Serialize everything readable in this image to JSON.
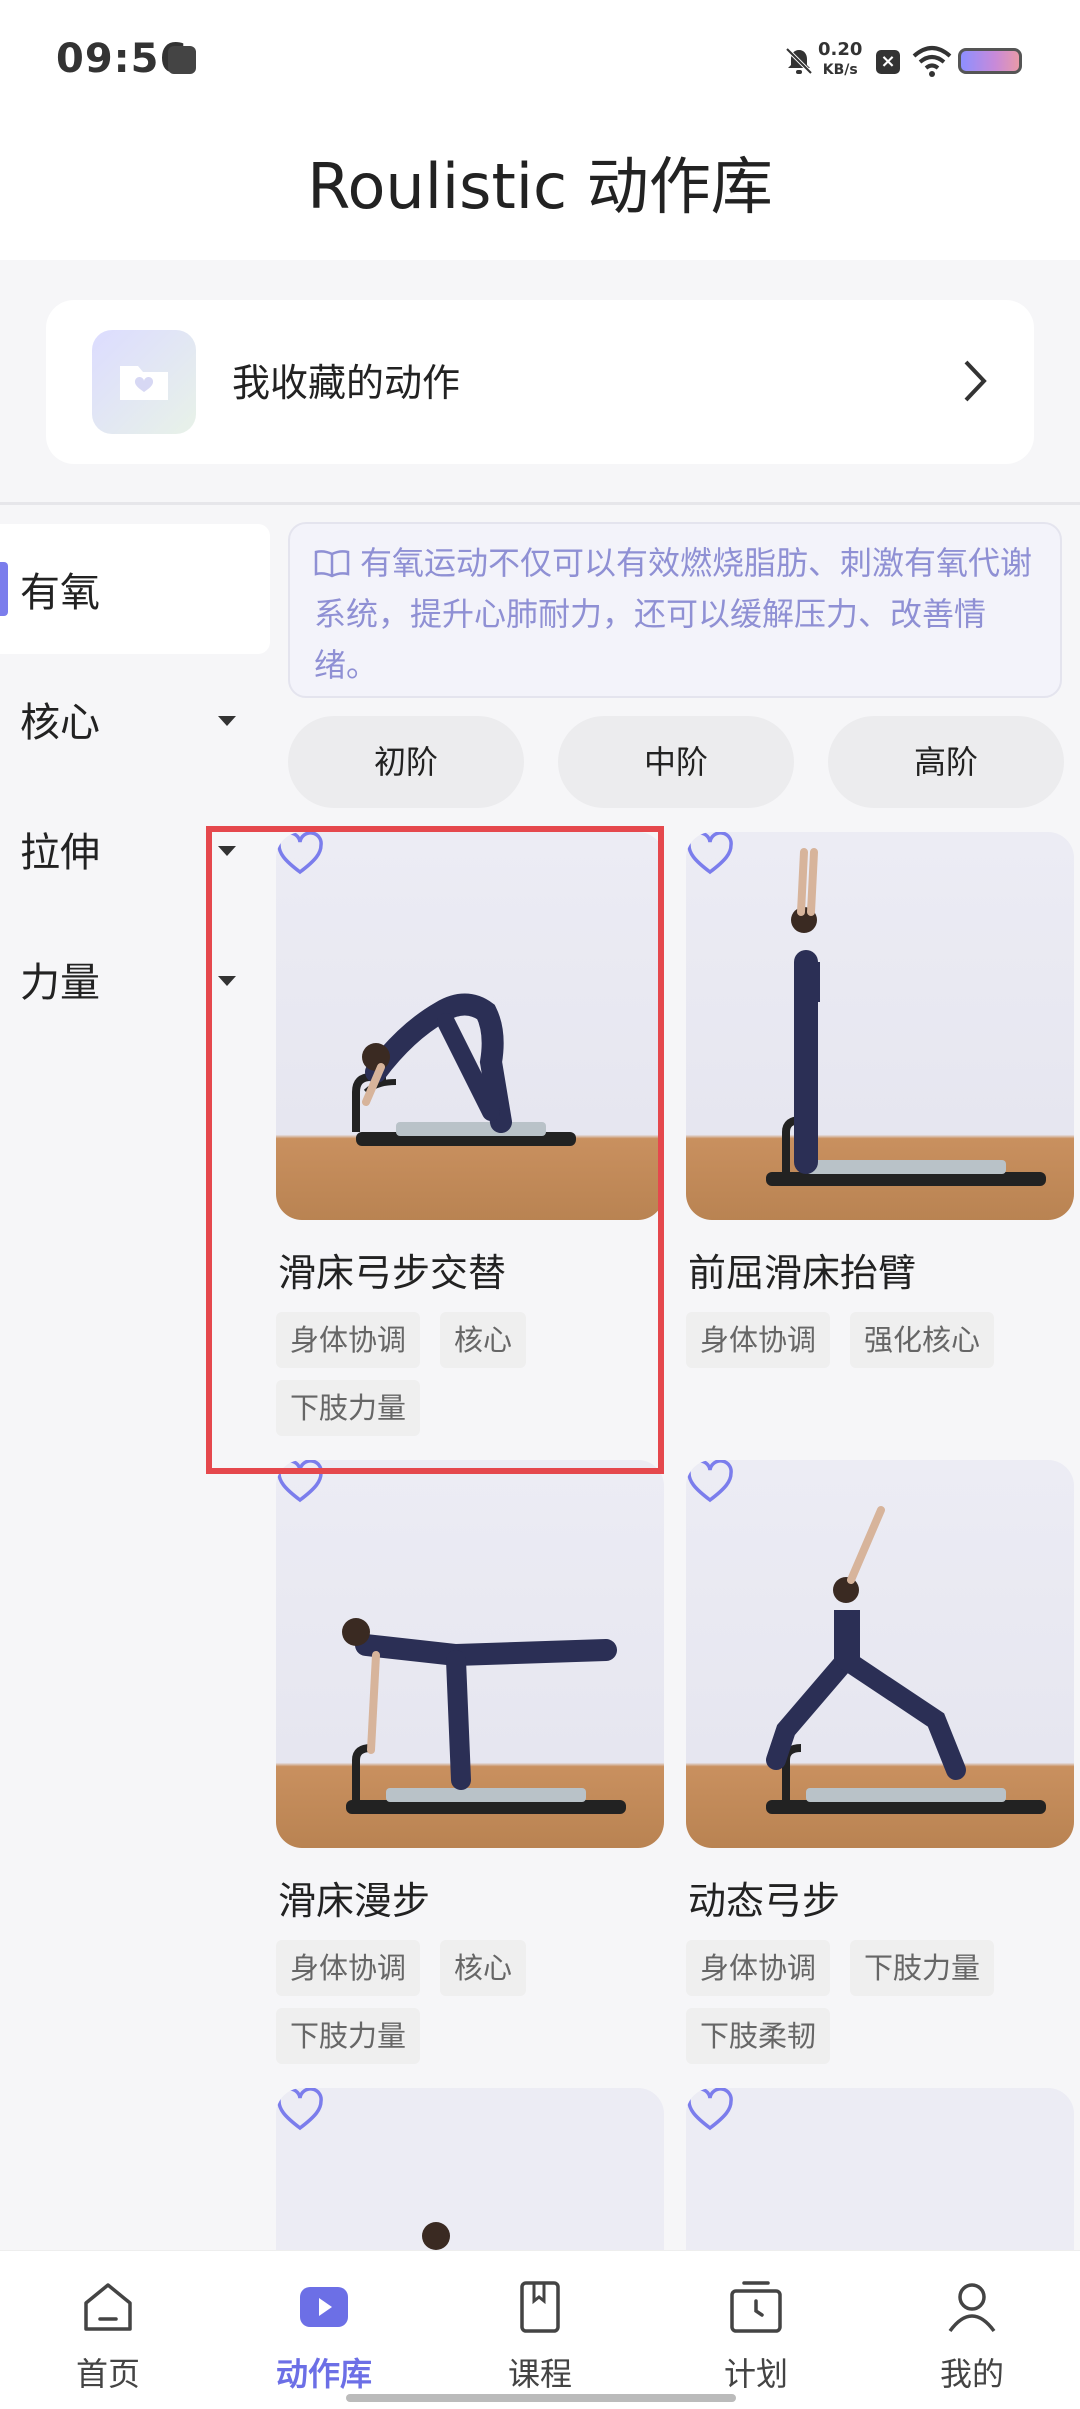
{
  "status": {
    "time": "09:56",
    "net_speed": "0.20",
    "net_unit": "KB/s"
  },
  "header": {
    "title": "Roulistic 动作库"
  },
  "favorites": {
    "label": "我收藏的动作"
  },
  "sidebar": {
    "items": [
      {
        "label": "有氧",
        "active": true
      },
      {
        "label": "核心",
        "active": false
      },
      {
        "label": "拉伸",
        "active": false
      },
      {
        "label": "力量",
        "active": false
      }
    ]
  },
  "description": "有氧运动不仅可以有效燃烧脂肪、刺激有氧代谢系统，提升心肺耐力，还可以缓解压力、改善情绪。",
  "levels": [
    "初阶",
    "中阶",
    "高阶"
  ],
  "cards": [
    {
      "title": "滑床弓步交替",
      "tags": [
        "身体协调",
        "核心",
        "下肢力量"
      ]
    },
    {
      "title": "前屈滑床抬臂",
      "tags": [
        "身体协调",
        "强化核心"
      ]
    },
    {
      "title": "滑床漫步",
      "tags": [
        "身体协调",
        "核心",
        "下肢力量"
      ]
    },
    {
      "title": "动态弓步",
      "tags": [
        "身体协调",
        "下肢力量",
        "下肢柔韧"
      ]
    }
  ],
  "tabbar": {
    "items": [
      {
        "label": "首页",
        "icon": "home-icon"
      },
      {
        "label": "动作库",
        "icon": "play-icon"
      },
      {
        "label": "课程",
        "icon": "book-icon"
      },
      {
        "label": "计划",
        "icon": "clock-icon"
      },
      {
        "label": "我的",
        "icon": "user-icon"
      }
    ]
  },
  "colors": {
    "accent": "#6c6fe6",
    "highlight": "#e5484d"
  }
}
